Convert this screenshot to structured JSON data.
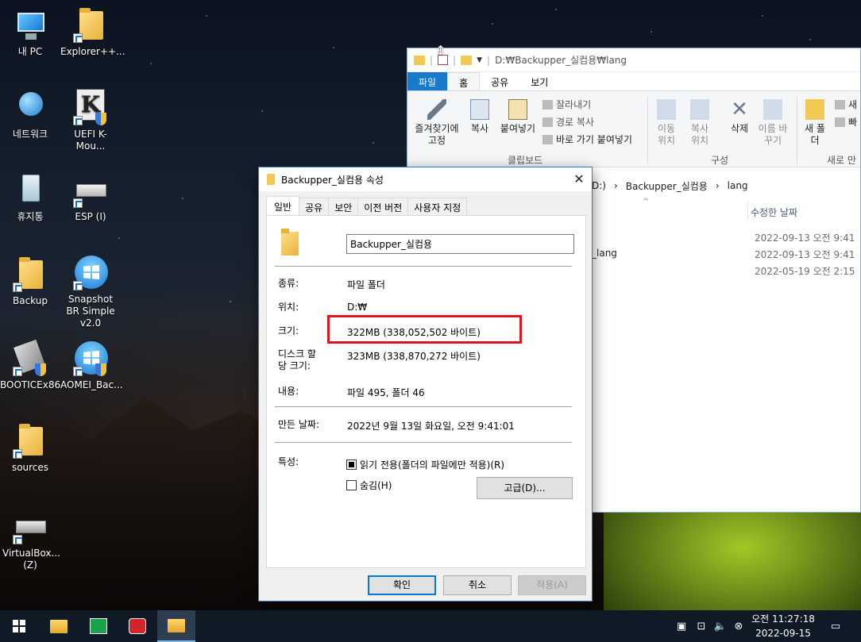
{
  "desktop": {
    "icons": [
      {
        "label": "내 PC",
        "icon": "computer-icon"
      },
      {
        "label": "Explorer++...",
        "icon": "folder-icon"
      },
      {
        "label": "네트워크",
        "icon": "network-globe-icon"
      },
      {
        "label": "UEFI K-Mou...",
        "icon": "k-app-icon"
      },
      {
        "label": "휴지통",
        "icon": "recycle-bin-icon"
      },
      {
        "label": "ESP (I)",
        "icon": "drive-icon"
      },
      {
        "label": "Backup",
        "icon": "folder-icon"
      },
      {
        "label": "Snapshot BR Simple v2.0",
        "icon": "windows-app-icon"
      },
      {
        "label": "BOOTICEx86",
        "icon": "tool-icon"
      },
      {
        "label": "AOMEI_Bac...",
        "icon": "windows-app-icon"
      },
      {
        "label": "sources",
        "icon": "folder-icon"
      },
      {
        "label": "VirtualBox... (Z)",
        "icon": "network-drive-icon"
      }
    ]
  },
  "explorer": {
    "path_title": "D:₩Backupper_실컴용₩lang",
    "tabs": [
      "파일",
      "홈",
      "공유",
      "보기"
    ],
    "ribbon": {
      "pin_label": "즐겨찾기에 고정",
      "copy_label": "복사",
      "paste_label": "붙여넣기",
      "cut_label": "잘라내기",
      "copy_path_label": "경로 복사",
      "paste_shortcut_label": "바로 가기 붙여넣기",
      "clipboard_group": "클립보드",
      "move_to_label": "이동 위치",
      "copy_to_label": "복사 위치",
      "delete_label": "삭제",
      "rename_label": "이름 바꾸기",
      "organize_group": "구성",
      "new_folder_label": "새 폴더",
      "new_item_label": "새",
      "easy_access_label": "빠",
      "new_group": "새로 만"
    },
    "address": {
      "drive": "D:)",
      "sep1": "›",
      "folder": "Backupper_실컴용",
      "sep2": "›",
      "sub": "lang"
    },
    "column_modified": "수정한 날짜",
    "rows": [
      {
        "name": "",
        "date": "2022-09-13 오전 9:41"
      },
      {
        "name": "_lang",
        "date": "2022-09-13 오전 9:41"
      },
      {
        "name": "",
        "date": "2022-05-19 오전 2:15"
      }
    ]
  },
  "dialog": {
    "title": "Backupper_실컴용 속성",
    "tabs": [
      "일반",
      "공유",
      "보안",
      "이전 버전",
      "사용자 지정"
    ],
    "folder_name": "Backupper_실컴용",
    "type_label": "종류:",
    "type_value": "파일 폴더",
    "location_label": "위치:",
    "location_value": "D:₩",
    "size_label": "크기:",
    "size_value": "322MB (338,052,502 바이트)",
    "disk_size_label": "디스크 할\n당 크기:",
    "disk_size_value": "323MB (338,870,272 바이트)",
    "contains_label": "내용:",
    "contains_value": "파일 495, 폴더 46",
    "created_label": "만든 날짜:",
    "created_value": "2022년 9월 13일 화요일, 오전 9:41:01",
    "attributes_label": "특성:",
    "readonly_label": "읽기 전용(폴더의 파일에만 적용)(R)",
    "hidden_label": "숨김(H)",
    "advanced_button": "고급(D)...",
    "ok_button": "확인",
    "cancel_button": "취소",
    "apply_button": "적용(A)"
  },
  "taskbar": {
    "clock_time": "오전 11:27:18",
    "clock_date": "2022-09-15"
  }
}
